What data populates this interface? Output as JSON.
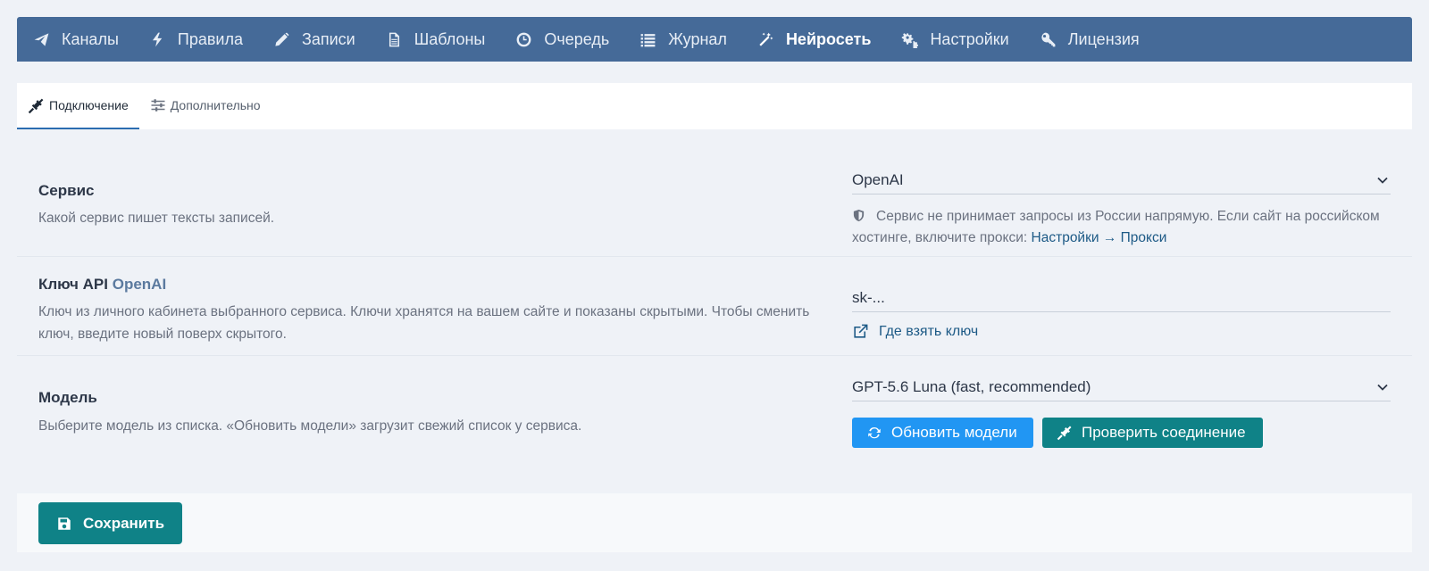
{
  "nav": {
    "items": [
      {
        "label": "Каналы",
        "icon": "paper-plane-icon",
        "active": false
      },
      {
        "label": "Правила",
        "icon": "bolt-icon",
        "active": false
      },
      {
        "label": "Записи",
        "icon": "pencil-icon",
        "active": false
      },
      {
        "label": "Шаблоны",
        "icon": "file-text-icon",
        "active": false
      },
      {
        "label": "Очередь",
        "icon": "clock-icon",
        "active": false
      },
      {
        "label": "Журнал",
        "icon": "list-icon",
        "active": false
      },
      {
        "label": "Нейросеть",
        "icon": "magic-wand-icon",
        "active": true
      },
      {
        "label": "Настройки",
        "icon": "cogs-icon",
        "active": false
      },
      {
        "label": "Лицензия",
        "icon": "key-icon",
        "active": false
      }
    ]
  },
  "tabs": [
    {
      "label": "Подключение",
      "icon": "plug-icon",
      "active": true
    },
    {
      "label": "Дополнительно",
      "icon": "sliders-icon",
      "active": false
    }
  ],
  "service": {
    "title": "Сервис",
    "desc": "Какой сервис пишет тексты записей.",
    "value": "OpenAI",
    "note_text": "Сервис не принимает запросы из России напрямую. Если сайт на российском хостинге, включите прокси: ",
    "note_link": "Настройки → Прокси"
  },
  "api_key": {
    "title_prefix": "Ключ API",
    "title_accent": "OpenAI",
    "desc": "Ключ из личного кабинета выбранного сервиса. Ключи хранятся на вашем сайте и показаны скрытыми. Чтобы сменить ключ, введите новый поверх скрытого.",
    "value": "sk-...",
    "link": "Где взять ключ"
  },
  "model": {
    "title": "Модель",
    "desc": "Выберите модель из списка. «Обновить модели» загрузит свежий список у сервиса.",
    "value": "GPT-5.6 Luna (fast, recommended)",
    "refresh_label": "Обновить модели",
    "check_label": "Проверить соединение"
  },
  "footer": {
    "save_label": "Сохранить"
  },
  "colors": {
    "nav_bg": "#456a98",
    "btn_blue": "#2196f3",
    "btn_teal": "#0f8287",
    "link": "#1d5a86",
    "page_bg": "#eff2f7"
  }
}
